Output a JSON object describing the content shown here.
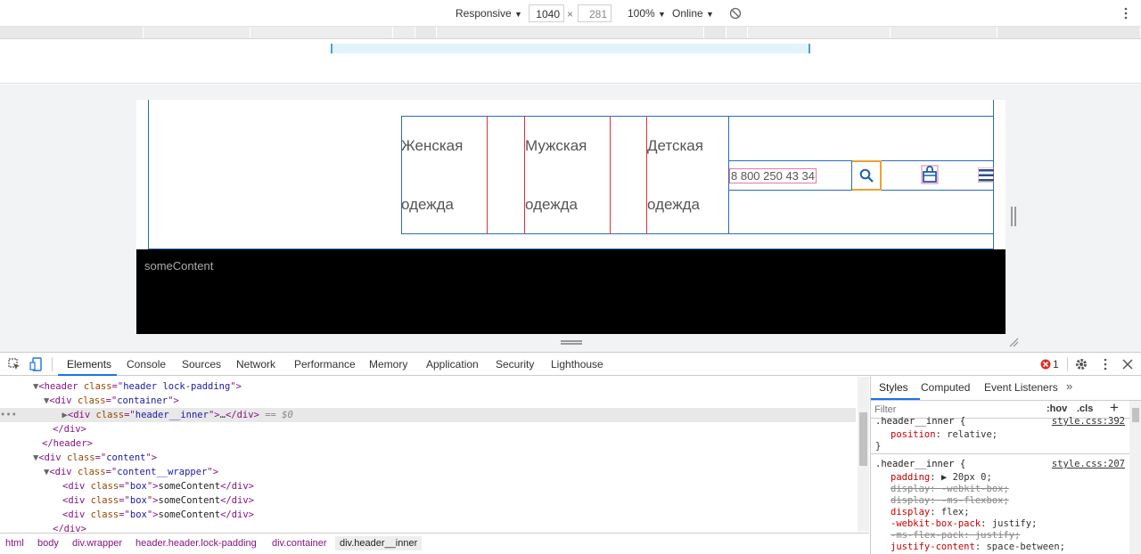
{
  "toolbar": {
    "device": "Responsive",
    "width": "1040",
    "height": "281",
    "times": "×",
    "zoom": "100%",
    "throttle": "Online",
    "caret": "▼"
  },
  "page": {
    "nav": [
      {
        "line1": "Женская",
        "line2": "одежда"
      },
      {
        "line1": "Мужская",
        "line2": "одежда"
      },
      {
        "line1": "Детская",
        "line2": "одежда"
      }
    ],
    "phone": "8 800 250 43 34",
    "content_text": "someContent"
  },
  "devtools": {
    "tabs": [
      "Elements",
      "Console",
      "Sources",
      "Network",
      "Performance",
      "Memory",
      "Application",
      "Security",
      "Lighthouse"
    ],
    "error_count": "1",
    "dom": {
      "l1_tag": "header",
      "l1_class": "header lock-padding",
      "l2_tag": "div",
      "l2_class": "container",
      "l3_tag": "div",
      "l3_class": "header__inner",
      "l3_suffix": "== $0",
      "ellipsis": "…",
      "l4_close": "</div>",
      "l5_close": "</header>",
      "l6_tag": "div",
      "l6_class": "content",
      "l7_tag": "div",
      "l7_class": "content__wrapper",
      "box_class": "box",
      "box_text": "someContent",
      "l11_close": "</div>"
    },
    "breadcrumbs": [
      "html",
      "body",
      "div.wrapper",
      "header.header.lock-padding",
      "div.container",
      "div.header__inner"
    ],
    "styles_tabs": [
      "Styles",
      "Computed",
      "Event Listeners"
    ],
    "filter_placeholder": "Filter",
    "hov": ":hov",
    "cls": ".cls",
    "rule1": {
      "selector": ".header__inner {",
      "source": "style.css:392",
      "prop": "position",
      "value": "relative;"
    },
    "rule2": {
      "selector": ".header__inner {",
      "source": "style.css:207",
      "decls": [
        {
          "prop": "padding",
          "value": "▶ 20px 0;",
          "struck": false
        },
        {
          "prop": "display",
          "value": "-webkit-box;",
          "struck": true
        },
        {
          "prop": "display",
          "value": "-ms-flexbox;",
          "struck": true
        },
        {
          "prop": "display",
          "value": "flex;",
          "struck": false
        },
        {
          "prop": "-webkit-box-pack",
          "value": "justify;",
          "struck": false
        },
        {
          "prop": "-ms-flex-pack",
          "value": "justify;",
          "struck": true
        },
        {
          "prop": "justify-content",
          "value": "space-between;",
          "struck": false
        }
      ]
    }
  }
}
